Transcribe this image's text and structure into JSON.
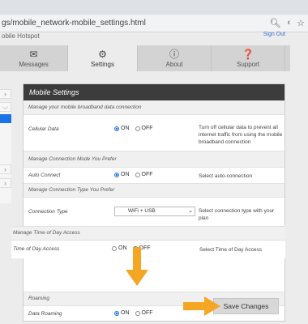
{
  "browser": {
    "url": "gs/mobile_network-mobile_settings.html",
    "zoom_icon": "zoom-icon",
    "share_icon": "share-icon",
    "star_icon": "star-icon"
  },
  "page": {
    "title": "obile Hotspot",
    "signout": "Sign Out"
  },
  "nav": [
    {
      "label": "Messages",
      "icon": "envelope-icon"
    },
    {
      "label": "Settings",
      "icon": "gear-icon"
    },
    {
      "label": "About",
      "icon": "info-icon"
    },
    {
      "label": "Support",
      "icon": "question-icon"
    }
  ],
  "panel": {
    "title": "Mobile Settings",
    "section_broadband": "Manage your mobile broadband data connection",
    "cellular": {
      "label": "Cellular Data",
      "on": "ON",
      "off": "OFF",
      "value": "ON",
      "desc": "Turn off cellular data to prevent all internet traffic from using the mobile broadband connection"
    },
    "section_mode": "Manage Connection Mode You Prefer",
    "autoconnect": {
      "label": "Auto Connect",
      "on": "ON",
      "off": "OFF",
      "value": "ON",
      "desc": "Select auto-connection"
    },
    "section_type": "Manage Connection Type You Prefer",
    "conntype": {
      "label": "Connection Type",
      "value": "WiFi + USB",
      "desc": "Select connection type with your plan"
    },
    "section_time": "Manage Time of Day Access",
    "timeofday": {
      "label": "Time of Day Access",
      "on": "ON",
      "off": "OFF",
      "value": "OFF",
      "desc": "Select Time of Day Access"
    },
    "section_roaming": "Roaming",
    "roaming": {
      "label": "Data Roaming",
      "on": "ON",
      "off": "OFF",
      "value": "ON"
    },
    "save": "Save Changes"
  },
  "colors": {
    "accent": "#1a73e8",
    "arrow": "#f5a623",
    "header": "#3c3c3c"
  }
}
